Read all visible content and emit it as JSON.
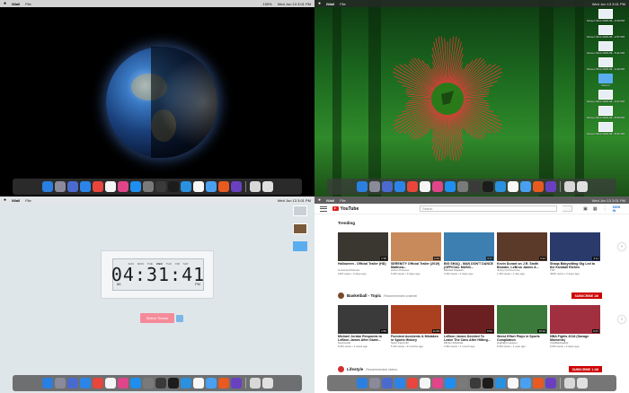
{
  "menubar": {
    "apple": "",
    "app_name": "iWall",
    "file_menu": "File",
    "clock": "Wed Jun 13 3:01 PM",
    "battery": "100%"
  },
  "q2": {
    "desktop_icons": [
      {
        "label": "Screen Shot 2018-06...3.20 PM"
      },
      {
        "label": "Screen Shot 2018-06...2.57 PM"
      },
      {
        "label": "Screen Shot 2018-06...5.41 PM"
      },
      {
        "label": "Screen Shot 2018-06...4.49 PM"
      },
      {
        "label": "Droom"
      },
      {
        "label": "Screen Shot 2018-06...0.37 PM"
      },
      {
        "label": "Screen Shot 2018-06...8.59 PM"
      },
      {
        "label": "Screen Shot 2018-06...8.41 PM"
      }
    ],
    "menubar_clock": "Wed Jun 13 3:01 PM"
  },
  "q3": {
    "clock_time": "04:31:41",
    "clock_ampm": "PM",
    "clock_days": [
      "SUN",
      "MON",
      "TUE",
      "WED",
      "THU",
      "FRI",
      "SAT"
    ],
    "clock_small": "88",
    "select_theme": "Select Theme",
    "menubar_clock": "Wed Jun 13 3:01 PM"
  },
  "q4": {
    "logo_text": "YouTube",
    "search_placeholder": "Search",
    "sign_in": "SIGN IN",
    "trending_label": "Trending",
    "trending": [
      {
        "title": "Halloween - Official Trailer (HD)",
        "channel": "Universal Pictures",
        "meta": "13M views • 4 days ago",
        "dur": "2:38",
        "color": "#3a3630"
      },
      {
        "title": "SERENITY Official Trailer (2019) Matthew...",
        "channel": "Aviron Pictures",
        "meta": "5.2M views • 3 days ago",
        "dur": "2:24",
        "color": "#c88a5a"
      },
      {
        "title": "BIG SHAQ - MAN DON'T DANCE (OFFICIAL MUSIC...",
        "channel": "Michael Dapaah",
        "meta": "3.4M views • 4 days ago",
        "dur": "3:17",
        "color": "#3c7fb0"
      },
      {
        "title": "Kevin Durant on J.R. Smith Blunder, LeBron James &...",
        "channel": "Jimmy Kimmel Live",
        "meta": "1.3M views • 1 day ago",
        "dur": "6:22",
        "color": "#5b3a2a"
      },
      {
        "title": "Shaqs Babysitting Gig Led to the Kickball Riches",
        "channel": "TNT",
        "meta": "493K views • 2 days ago",
        "dur": "4:11",
        "color": "#2a3a6a"
      }
    ],
    "channel_name": "Basketball - Topic",
    "channel_sub": "Recommended channel",
    "subscribe1": "SUBSCRIBE 1M",
    "row2": [
      {
        "title": "Michael Jordan Responds to LeBron James After Game...",
        "channel": "SportsHub",
        "meta": "8.2M views • 1 week ago",
        "dur": "1:56",
        "color": "#3a3a3a"
      },
      {
        "title": "Funniest Accidents & Mistakes in Sports History",
        "channel": "Sport Field HD",
        "meta": "5.1M views • 9 months ago",
        "dur": "11:09",
        "color": "#aa4020"
      },
      {
        "title": "LeBron James Decided To Leave The Cavs After Hitting...",
        "channel": "MKSH SAVAGE",
        "meta": "2.9M views • 1 month ago",
        "dur": "8:52",
        "color": "#6a2020"
      },
      {
        "title": "Worst Effort Plays in Sports Compilation",
        "channel": "Highlight Heaven",
        "meta": "8.3M views • 1 year ago",
        "dur": "10:22",
        "color": "#3c7a3c"
      },
      {
        "title": "NBA Fights 2018 (Savage Moments)",
        "channel": "ClickBaitHeads",
        "meta": "6.6M views • 2 days ago",
        "dur": "6:47",
        "color": "#a03040"
      }
    ],
    "lifestyle_name": "Lifestyle",
    "lifestyle_sub": "Recommended videos",
    "subscribe2": "SUBSCRIBE 1.1M",
    "menubar_clock": "Wed Jun 13 3:01 PM"
  },
  "dock_colors": [
    "#2a7fe0",
    "#8a8a9a",
    "#4a6ad0",
    "#2c84e8",
    "#e8453c",
    "#f5f5f5",
    "#e0458a",
    "#1e8ef0",
    "#7a7a7a",
    "#3a3a3a",
    "#1c1c1c",
    "#2a90e0",
    "#f8f8f8",
    "#4aa0f0",
    "#e85a20",
    "#6a40c0",
    "#d8d8d8",
    "#e0e0e0"
  ]
}
